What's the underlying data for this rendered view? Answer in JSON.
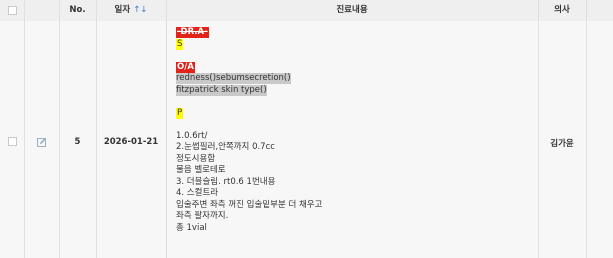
{
  "header": {
    "no": "No.",
    "date": "일자",
    "sort_icon": "↑↓",
    "content": "진료내용",
    "doctor": "의사"
  },
  "row": {
    "no": "5",
    "date": "2026-01-21",
    "doctor": "김가윤",
    "edit_icon": "edit-icon",
    "content": {
      "dra": "-DR.A-",
      "s": "S",
      "oa": "O/A",
      "o_line1": "redness()sebumsecretion()",
      "o_line2": "fitzpatrick skin type()",
      "p": "P",
      "plan": [
        "1.0.6rt/",
        "2.눈썹필러,안쪽까지 0.7cc",
        "정도시용함",
        "물음 벨로테로",
        "3. 더블슬림. rt0.6 1번내용",
        "4. 스컬트라",
        "입술주변 좌측 꺼진 입술밑부분 더 채우고",
        "좌측 팔자까지.",
        "총 1vial"
      ]
    }
  },
  "colors": {
    "header_bg": "#efefef",
    "row_bg": "#f7f7f7",
    "tag_red": "#e2231a",
    "highlight_yellow": "#ffff00",
    "highlight_gray": "#c9c9c9",
    "sort_blue": "#3a7bd5"
  }
}
